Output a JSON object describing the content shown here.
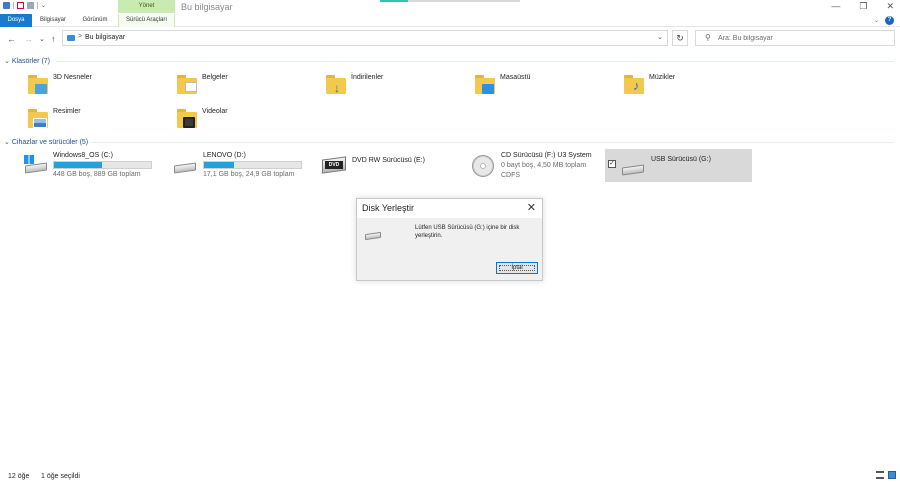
{
  "window": {
    "title": "Bu bilgisayar",
    "context_group": "Yönet",
    "controls": {
      "minimize": "—",
      "maximize": "❐",
      "close": "✕"
    }
  },
  "ribbon": {
    "tabs": [
      {
        "label": "Dosya"
      },
      {
        "label": "Bilgisayar"
      },
      {
        "label": "Görünüm"
      },
      {
        "label": "Sürücü Araçları"
      }
    ],
    "help": "?",
    "collapse": "⌄"
  },
  "nav": {
    "back": "←",
    "forward": "→",
    "recent": "⌄",
    "up": "↑",
    "breadcrumb_sep": ">",
    "address": "Bu bilgisayar",
    "address_dropdown": "⌄",
    "refresh": "↻",
    "search_icon": "⚲",
    "search_placeholder": "Ara: Bu bilgisayar"
  },
  "folders_group": {
    "arrow": "⌄",
    "title": "Klasörler (7)",
    "items": [
      {
        "label": "3D Nesneler",
        "icon": "3d-objects-folder-icon"
      },
      {
        "label": "Belgeler",
        "icon": "documents-folder-icon"
      },
      {
        "label": "İndirilenler",
        "icon": "downloads-folder-icon"
      },
      {
        "label": "Masaüstü",
        "icon": "desktop-folder-icon"
      },
      {
        "label": "Müzikler",
        "icon": "music-folder-icon"
      },
      {
        "label": "Resimler",
        "icon": "pictures-folder-icon"
      },
      {
        "label": "Videolar",
        "icon": "videos-folder-icon"
      }
    ]
  },
  "drives_group": {
    "arrow": "⌄",
    "title": "Cihazlar ve sürücüler (5)",
    "items": [
      {
        "name": "Windows8_OS (C:)",
        "sub": "448 GB boş, 889 GB toplam",
        "used_fraction": 0.496
      },
      {
        "name": "LENOVO (D:)",
        "sub": "17,1 GB boş, 24,9 GB toplam",
        "used_fraction": 0.313
      },
      {
        "name": "DVD RW Sürücüsü (E:)",
        "dvd_label": "DVD"
      },
      {
        "name": "CD Sürücüsü (F:) U3 System",
        "sub": "0 bayt boş, 4,50 MB toplam",
        "sub2": "CDFS"
      },
      {
        "name": "USB Sürücüsü (G:)",
        "checkbox": "✓"
      }
    ]
  },
  "dialog": {
    "title": "Disk Yerleştir",
    "close": "✕",
    "message": "Lütfen USB Sürücüsü (G:) içine bir disk yerleştirin.",
    "button": "İptal"
  },
  "status": {
    "count": "12 öğe",
    "selected": "1 öğe seçildi"
  },
  "colors": {
    "accent": "#1979ca",
    "context_tab": "#c9eab0",
    "drive_bar": "#26a0da",
    "selection": "#d9d9d9"
  }
}
